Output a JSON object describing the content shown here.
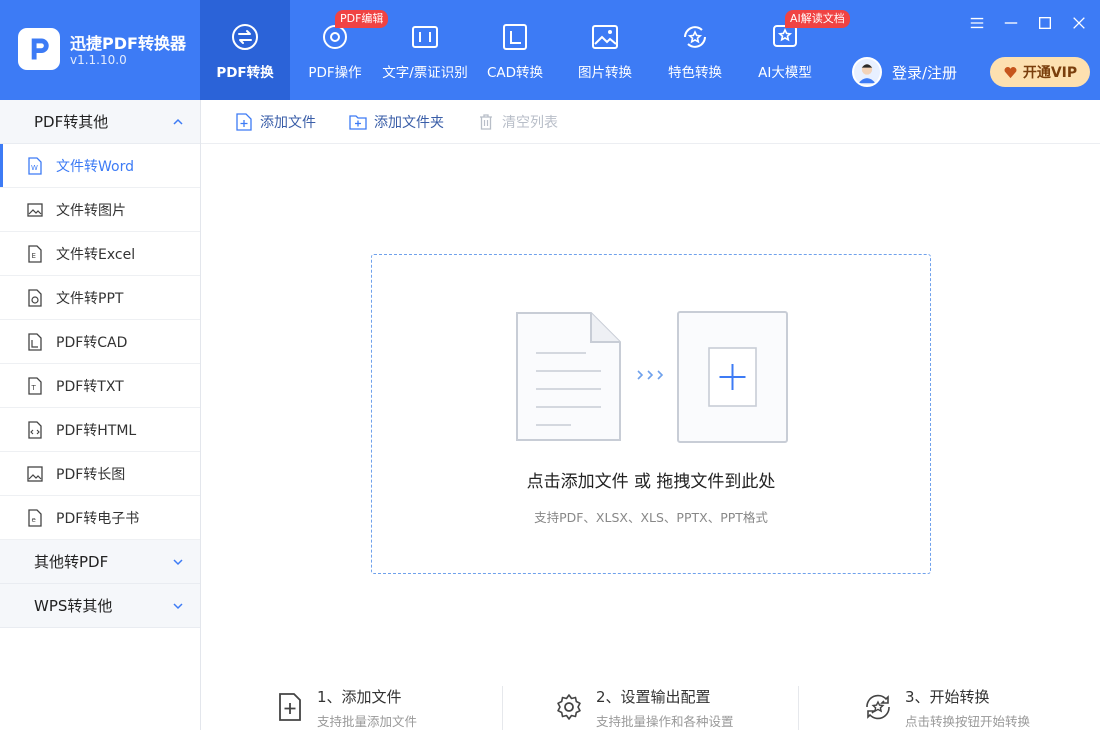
{
  "app": {
    "name": "迅捷PDF转换器",
    "version": "v1.1.10.0"
  },
  "nav": [
    {
      "label": "PDF转换",
      "icon": "convert-icon",
      "badge": ""
    },
    {
      "label": "PDF操作",
      "icon": "gear-icon",
      "badge": "PDF编辑"
    },
    {
      "label": "文字/票证识别",
      "icon": "ocr-scan-icon",
      "badge": ""
    },
    {
      "label": "CAD转换",
      "icon": "cad-icon",
      "badge": ""
    },
    {
      "label": "图片转换",
      "icon": "image-icon",
      "badge": ""
    },
    {
      "label": "特色转换",
      "icon": "star-convert-icon",
      "badge": ""
    },
    {
      "label": "AI大模型",
      "icon": "ai-icon",
      "badge": "AI解读文档"
    }
  ],
  "user": {
    "login_label": "登录/注册"
  },
  "vip": {
    "label": "开通VIP"
  },
  "window": {
    "menu": "menu-icon",
    "minimize": "minimize-icon",
    "maximize": "maximize-icon",
    "close": "close-icon"
  },
  "sidebar": {
    "section_open": "PDF转其他",
    "items": [
      {
        "label": "文件转Word",
        "icon": "word-file-icon"
      },
      {
        "label": "文件转图片",
        "icon": "image-file-icon"
      },
      {
        "label": "文件转Excel",
        "icon": "excel-file-icon"
      },
      {
        "label": "文件转PPT",
        "icon": "ppt-file-icon"
      },
      {
        "label": "PDF转CAD",
        "icon": "cad-file-icon"
      },
      {
        "label": "PDF转TXT",
        "icon": "txt-file-icon"
      },
      {
        "label": "PDF转HTML",
        "icon": "html-file-icon"
      },
      {
        "label": "PDF转长图",
        "icon": "long-image-icon"
      },
      {
        "label": "PDF转电子书",
        "icon": "ebook-icon"
      }
    ],
    "section_2": "其他转PDF",
    "section_3": "WPS转其他"
  },
  "toolbar": {
    "add_file": "添加文件",
    "add_folder": "添加文件夹",
    "clear_list": "清空列表"
  },
  "dropzone": {
    "main": "点击添加文件 或 拖拽文件到此处",
    "sub": "支持PDF、XLSX、XLS、PPTX、PPT格式"
  },
  "steps": [
    {
      "title": "1、添加文件",
      "desc": "支持批量添加文件"
    },
    {
      "title": "2、设置输出配置",
      "desc": "支持批量操作和各种设置"
    },
    {
      "title": "3、开始转换",
      "desc": "点击转换按钮开始转换"
    }
  ],
  "colors": {
    "accent": "#3d7bf5",
    "active_nav": "#2b63d8",
    "badge": "#f04343",
    "vip_bg": "#fde0b0"
  }
}
